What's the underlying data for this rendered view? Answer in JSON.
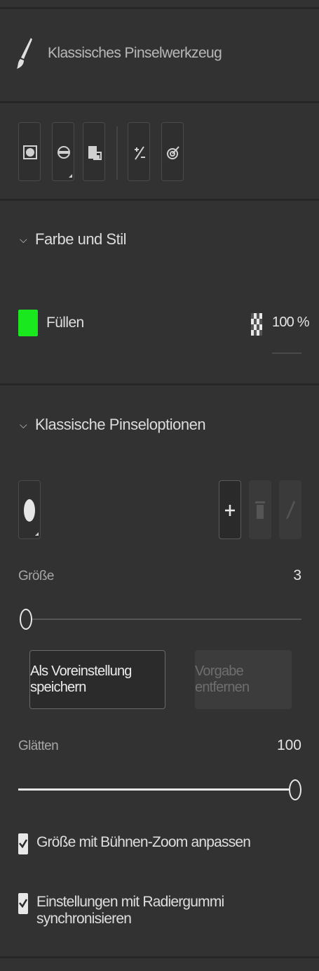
{
  "header": {
    "title": "Klassisches Pinselwerkzeug",
    "icon": "brush-icon"
  },
  "toolbar": {
    "buttons": [
      {
        "name": "object-drawing-icon"
      },
      {
        "name": "brush-mode-icon",
        "has_menu": true
      },
      {
        "name": "lock-fill-icon"
      },
      {
        "name": "pressure-icon"
      },
      {
        "name": "tilt-icon"
      }
    ]
  },
  "farbe": {
    "title": "Farbe und Stil",
    "fill_label": "Füllen",
    "fill_color": "#19e81e",
    "opacity": "100 %"
  },
  "pinsel": {
    "title": "Klassische Pinseloptionen",
    "groesse_label": "Größe",
    "groesse_value": "3",
    "groesse_fraction": 0.0,
    "save_preset_label": "Als Voreinstellung speichern",
    "remove_preset_label": "Vorgabe entfernen",
    "glaetten_label": "Glätten",
    "glaetten_value": "100",
    "glaetten_fraction": 1.0,
    "checkbox1_label": "Größe mit Bühnen-Zoom anpassen",
    "checkbox1_checked": true,
    "checkbox2_label": "Einstellungen mit Radiergummi synchronisieren",
    "checkbox2_checked": true
  }
}
